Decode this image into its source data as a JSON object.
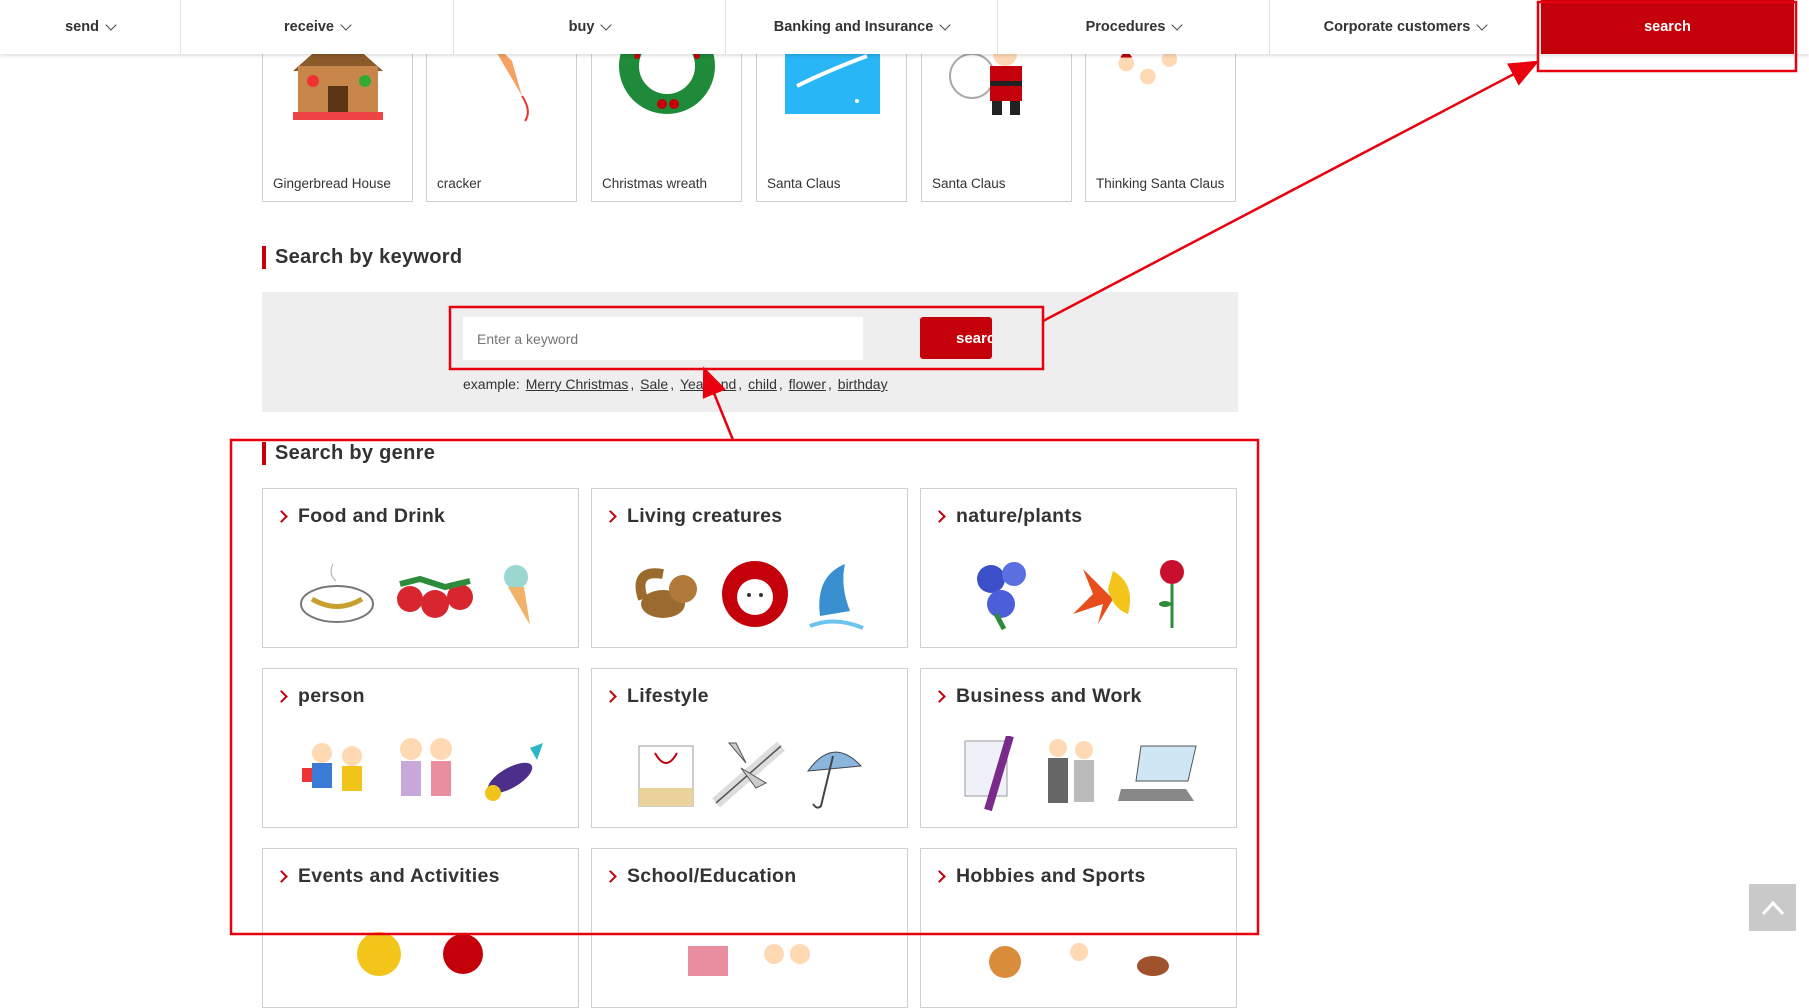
{
  "nav": {
    "items": [
      {
        "label": "send"
      },
      {
        "label": "receive"
      },
      {
        "label": "buy"
      },
      {
        "label": "Banking and Insurance"
      },
      {
        "label": "Procedures"
      },
      {
        "label": "Corporate customers"
      }
    ],
    "search_label": "search"
  },
  "illustrations": [
    {
      "caption": "Gingerbread House",
      "icon": "gingerbread-house-icon"
    },
    {
      "caption": "cracker",
      "icon": "party-cracker-icon"
    },
    {
      "caption": "Christmas wreath",
      "icon": "wreath-icon"
    },
    {
      "caption": "Santa Claus",
      "icon": "santa-sleigh-icon"
    },
    {
      "caption": "Santa Claus",
      "icon": "santa-icon"
    },
    {
      "caption": "Thinking Santa Claus",
      "icon": "thinking-santa-icon"
    }
  ],
  "keyword_section": {
    "title": "Search by keyword",
    "placeholder": "Enter a keyword",
    "button_label": "search",
    "example_prefix": "example:",
    "examples": [
      "Merry Christmas",
      "Sale",
      "Year-end",
      "child",
      "flower",
      "birthday"
    ]
  },
  "genre_section": {
    "title": "Search by genre",
    "genres": [
      {
        "label": "Food and Drink"
      },
      {
        "label": "Living creatures"
      },
      {
        "label": "nature/plants"
      },
      {
        "label": "person"
      },
      {
        "label": "Lifestyle"
      },
      {
        "label": "Business and Work"
      },
      {
        "label": "Events and Activities"
      },
      {
        "label": "School/Education"
      },
      {
        "label": "Hobbies and Sports"
      }
    ]
  },
  "colors": {
    "accent": "#c4000b",
    "annotation": "#e8000e"
  }
}
